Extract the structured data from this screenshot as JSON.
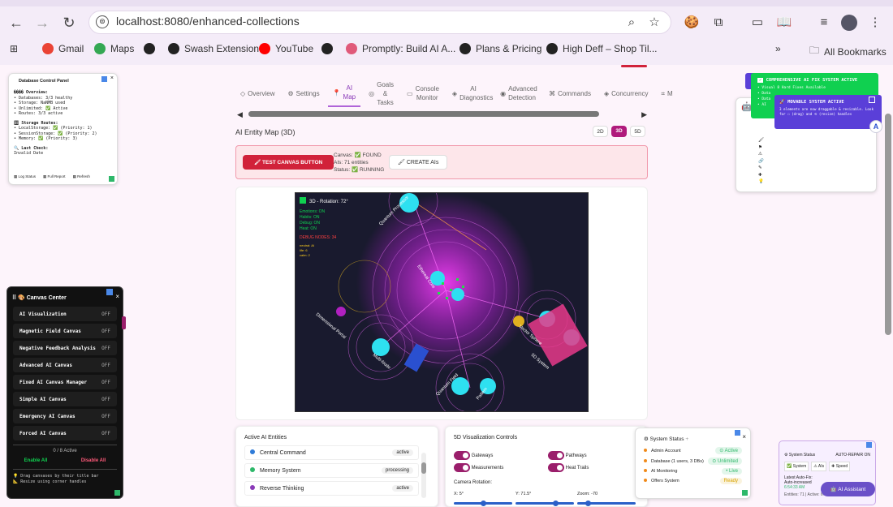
{
  "browser": {
    "url": "localhost:8080/enhanced-collections",
    "bookmarks": [
      {
        "label": "Gmail",
        "icon": "gmail-icon",
        "color": "#ea4335"
      },
      {
        "label": "Maps",
        "icon": "maps-icon",
        "color": "#34a853"
      },
      {
        "label": "",
        "icon": "globe-icon",
        "color": "#222"
      },
      {
        "label": "Swash Extension",
        "icon": "globe-icon",
        "color": "#222"
      },
      {
        "label": "YouTube",
        "icon": "youtube-icon",
        "color": "#ff0000"
      },
      {
        "label": "",
        "icon": "globe-icon",
        "color": "#222"
      },
      {
        "label": "Promptly: Build AI A...",
        "icon": "promptly-icon",
        "color": "#e05a7a"
      },
      {
        "label": "Plans & Pricing",
        "icon": "wix-icon",
        "color": "#222"
      },
      {
        "label": "High Deff – Shop Til...",
        "icon": "globe-icon",
        "color": "#222"
      }
    ],
    "all_bookmarks": "All Bookmarks"
  },
  "tabs": [
    {
      "label": "Overview",
      "icon": "overview-icon"
    },
    {
      "label": "Settings",
      "icon": "gear-icon"
    },
    {
      "label": "AI Map",
      "icon": "pin-icon"
    },
    {
      "label": "Goals & Tasks",
      "icon": "target-icon"
    },
    {
      "label": "Console Monitor",
      "icon": "console-icon"
    },
    {
      "label": "AI Diagnostics",
      "icon": "diagnostics-icon"
    },
    {
      "label": "Advanced Detection",
      "icon": "detection-icon"
    },
    {
      "label": "Commands",
      "icon": "command-icon"
    },
    {
      "label": "Concurrency",
      "icon": "concurrency-icon"
    },
    {
      "label": "M",
      "icon": "more-icon"
    }
  ],
  "ai_map": {
    "title": "AI Entity Map (3D)",
    "views": [
      "2D",
      "3D",
      "5D"
    ],
    "active_view": "3D",
    "test_button": "🖌 TEST CANVAS BUTTON",
    "status_lines": [
      "Canvas: ✅ FOUND",
      "AIs: 71 entities",
      "Status: ✅ RUNNING"
    ],
    "create_button": "🖌 CREATE AIs",
    "viz": {
      "header": "3D - Rotation: 72°",
      "info_green": [
        "Emotions: ON",
        "Habits: ON",
        "Debug: ON",
        "Heat: ON"
      ],
      "info_red": "DEBUG NODES: 34",
      "info_yellow": [
        "neutral: AI",
        "life: 6",
        "calm: 2"
      ],
      "node_labels": [
        "Quantum Processor",
        "Dimensional Portal",
        "Ethereal Core",
        "Vector Sphere",
        "Multi-Node",
        "Quantum Field",
        "5D System",
        "Pattern"
      ]
    }
  },
  "db_panel": {
    "title": "Database Control Panel",
    "overview_title": "���� Overview:",
    "overview": [
      "• Databases: 3/3 healthy",
      "• Storage: NaNMB used",
      "• Unlimited: ✅ Active",
      "• Routes: 3/3 active"
    ],
    "routes_title": "🗄 Storage Routes:",
    "routes": [
      "• LocalStorage: ✅ (Priority: 1)",
      "• SessionStorage: ✅ (Priority: 2)",
      "• Memory: ✅ (Priority: 3)"
    ],
    "last_check_title": "🔍 Last Check:",
    "last_check": "Invalid Date",
    "buttons": [
      "Log Status",
      "Full Report",
      "Refresh"
    ]
  },
  "canvas_center": {
    "title": "🎨 Canvas Center",
    "items": [
      {
        "label": "AI Visualization",
        "state": "OFF"
      },
      {
        "label": "Magnetic Field Canvas",
        "state": "OFF"
      },
      {
        "label": "Negative Feedback Analysis",
        "state": "OFF"
      },
      {
        "label": "Advanced AI Canvas",
        "state": "OFF"
      },
      {
        "label": "Fixed AI Canvas Manager",
        "state": "OFF"
      },
      {
        "label": "Simple AI Canvas",
        "state": "OFF"
      },
      {
        "label": "Emergency AI Canvas",
        "state": "OFF"
      },
      {
        "label": "Forced AI Canvas",
        "state": "OFF"
      }
    ],
    "count": "0 / 8 Active",
    "enable_all": "Enable All",
    "disable_all": "Disable All",
    "hint1": "💡 Drag canvases by their title bar",
    "hint2": "📐 Resize using corner handles"
  },
  "entities": {
    "title": "Active AI Entities",
    "items": [
      {
        "name": "Central Command",
        "status": "active",
        "color": "#2f7bd8"
      },
      {
        "name": "Memory System",
        "status": "processing",
        "color": "#2eb86a"
      },
      {
        "name": "Reverse Thinking",
        "status": "active",
        "color": "#8a3ab8"
      }
    ]
  },
  "controls5d": {
    "title": "5D Visualization Controls",
    "toggles": [
      "Gateways",
      "Pathways",
      "Measurements",
      "Heat Trails"
    ],
    "camera_title": "Camera Rotation:",
    "sliders": [
      {
        "label": "X: 5°",
        "value": 0.5
      },
      {
        "label": "Y: 71.5°",
        "value": 0.7
      },
      {
        "label": "Zoom: -70",
        "value": 0.15
      }
    ]
  },
  "system_status": {
    "title": "System Status",
    "rows": [
      {
        "label": "Admin Account",
        "badge": "⊙ Active",
        "color": "#2eb86a"
      },
      {
        "label": "Database (1 users, 3 DBs)",
        "badge": "⊙ Unlimited",
        "color": "#2eb86a"
      },
      {
        "label": "AI Monitoring",
        "badge": "• Live",
        "color": "#2eb86a"
      },
      {
        "label": "Offers System",
        "badge": "Ready",
        "color": "#d9a300"
      }
    ]
  },
  "auto_repair": {
    "title": "System Status",
    "mode": "AUTO-REPAIR ON",
    "chips": [
      "✅ System",
      "⚠ AIs",
      "✚ Speed"
    ],
    "fix_title": "Latest Auto-Fix:",
    "fix_text": "Auto-increased",
    "fix_time": "6:54:33 AM",
    "footer": "Entities: 71 | Active: 67",
    "assistant": "🤖 AI Assistant"
  },
  "fix_banner": {
    "title": "COMPREHENSIVE AI FIX SYSTEM ACTIVE",
    "lines": [
      "• Visual 8 Hard Fixes Available",
      "• Data",
      "• Data",
      "• AI"
    ]
  },
  "movable_banner": {
    "title": "MOVABLE SYSTEM ACTIVE",
    "text": "3 elements are now draggable & resizable. Look for ☐ (drag) and ⟲ (resize) handles"
  },
  "colors": {
    "accent": "#b01a7c",
    "test_red": "#d1223a",
    "green": "#10d050",
    "purple": "#5a3fd8"
  }
}
